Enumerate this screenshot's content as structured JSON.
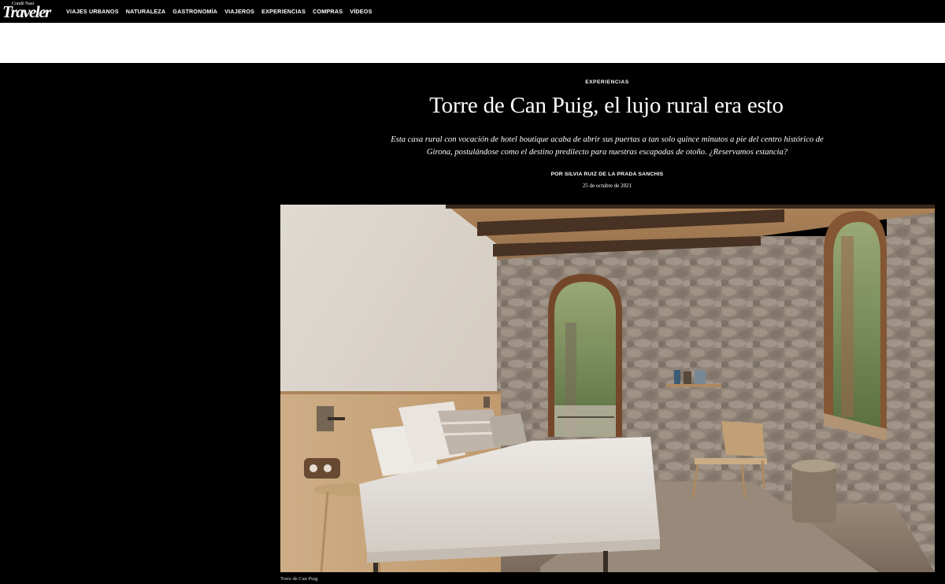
{
  "brand": {
    "logo_small": "Condé Nast",
    "logo_big": "Traveler"
  },
  "nav": {
    "items": [
      {
        "label": "VIAJES URBANOS"
      },
      {
        "label": "NATURALEZA"
      },
      {
        "label": "GASTRONOMÍA"
      },
      {
        "label": "VIAJEROS"
      },
      {
        "label": "EXPERIENCIAS"
      },
      {
        "label": "COMPRAS"
      },
      {
        "label": "VÍDEOS"
      }
    ]
  },
  "article": {
    "kicker": "EXPERIENCIAS",
    "title": "Torre de Can Puig, el lujo rural era esto",
    "dek": "Esta casa rural con vocación de hotel boutique acaba de abrir sus puertas a tan solo quince minutos a pie del centro histórico de Girona, postulándose como el destino predilecto para nuestras escapadas de otoño. ¿Reservamos estancia?",
    "byline": "POR SILVIA RUIZ DE LA PRADA SANCHIS",
    "date": "25 de octubre de 2021",
    "image_caption": "Torre de Can Puig"
  },
  "colors": {
    "background": "#000000",
    "ad_band": "#ffffff",
    "text": "#ffffff"
  }
}
